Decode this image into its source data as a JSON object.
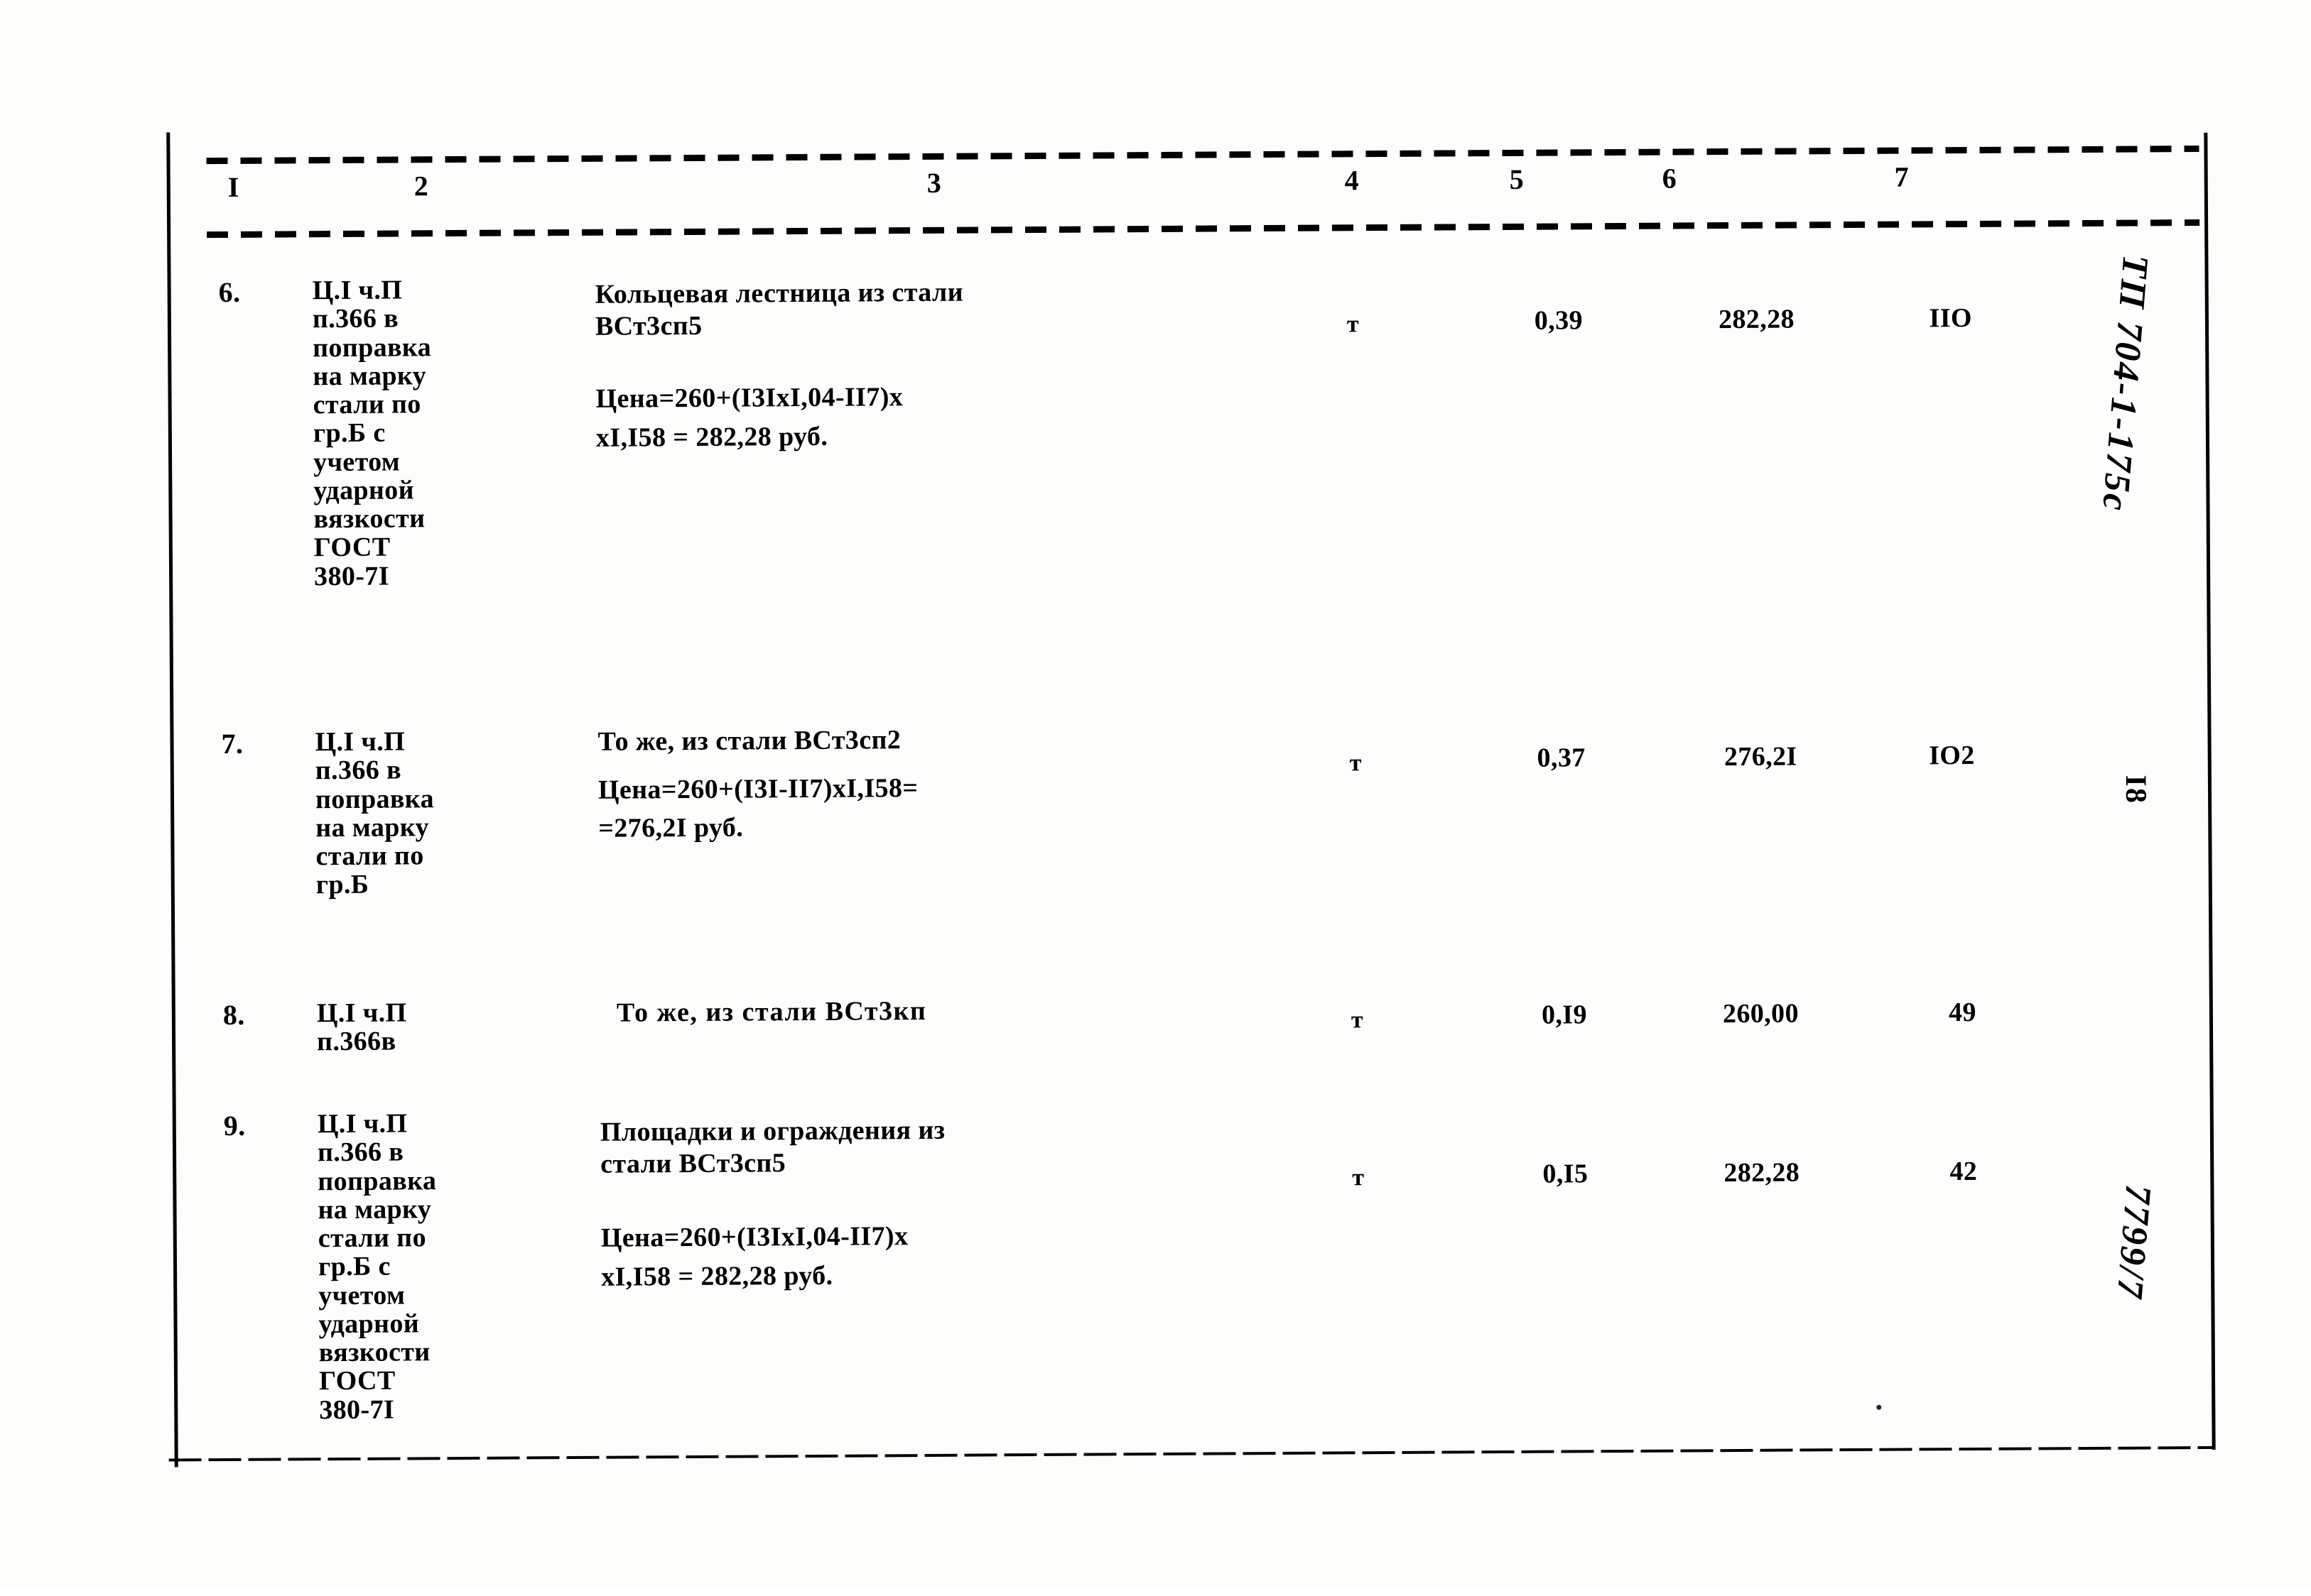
{
  "document": {
    "type": "cost-estimate-table",
    "page_number": "I8",
    "margin_annotations": {
      "top_right_handwritten": "ТП 704-1-175с",
      "bottom_right_handwritten": "7799/7"
    }
  },
  "table": {
    "column_headers": [
      "I",
      "2",
      "3",
      "4",
      "5",
      "6",
      "7"
    ],
    "rows": [
      {
        "num": "6.",
        "ref": "Ц.I ч.П\nп.366 в\nпоправка\nна марку\nстали по\nгр.Б с\nучетом\nударной\nвязкости\nГОСТ\n380-7I",
        "description_title": "Кольцевая лестница из стали\nВСт3сп5",
        "description_formula": "Цена=260+(I3IxI,04-II7)x\nxI,I58 = 282,28 руб.",
        "unit": "т",
        "qty": "0,39",
        "price": "282,28",
        "total": "IIO"
      },
      {
        "num": "7.",
        "ref": "Ц.I ч.П\nп.366 в\nпоправка\nна марку\nстали по\nгр.Б",
        "description_title": "То же, из стали ВСт3сп2",
        "description_formula": "Цена=260+(I3I-II7)xI,I58=\n  =276,2I руб.",
        "unit": "т",
        "qty": "0,37",
        "price": "276,2I",
        "total": "IO2"
      },
      {
        "num": "8.",
        "ref": "Ц.I ч.П\nп.366в",
        "description_title": "То же, из стали ВСт3кп",
        "description_formula": "",
        "unit": "т",
        "qty": "0,I9",
        "price": "260,00",
        "total": "49"
      },
      {
        "num": "9.",
        "ref": "Ц.I ч.П\nп.366 в\nпоправка\nна марку\nстали по\nгр.Б с\nучетом\nударной\nвязкости\nГОСТ\n380-7I",
        "description_title": "Площадки и ограждения из\nстали ВСт3сп5",
        "description_formula": "Цена=260+(I3IxI,04-II7)x\nxI,I58 = 282,28 руб.",
        "unit": "т",
        "qty": "0,I5",
        "price": "282,28",
        "total": "42"
      }
    ]
  }
}
